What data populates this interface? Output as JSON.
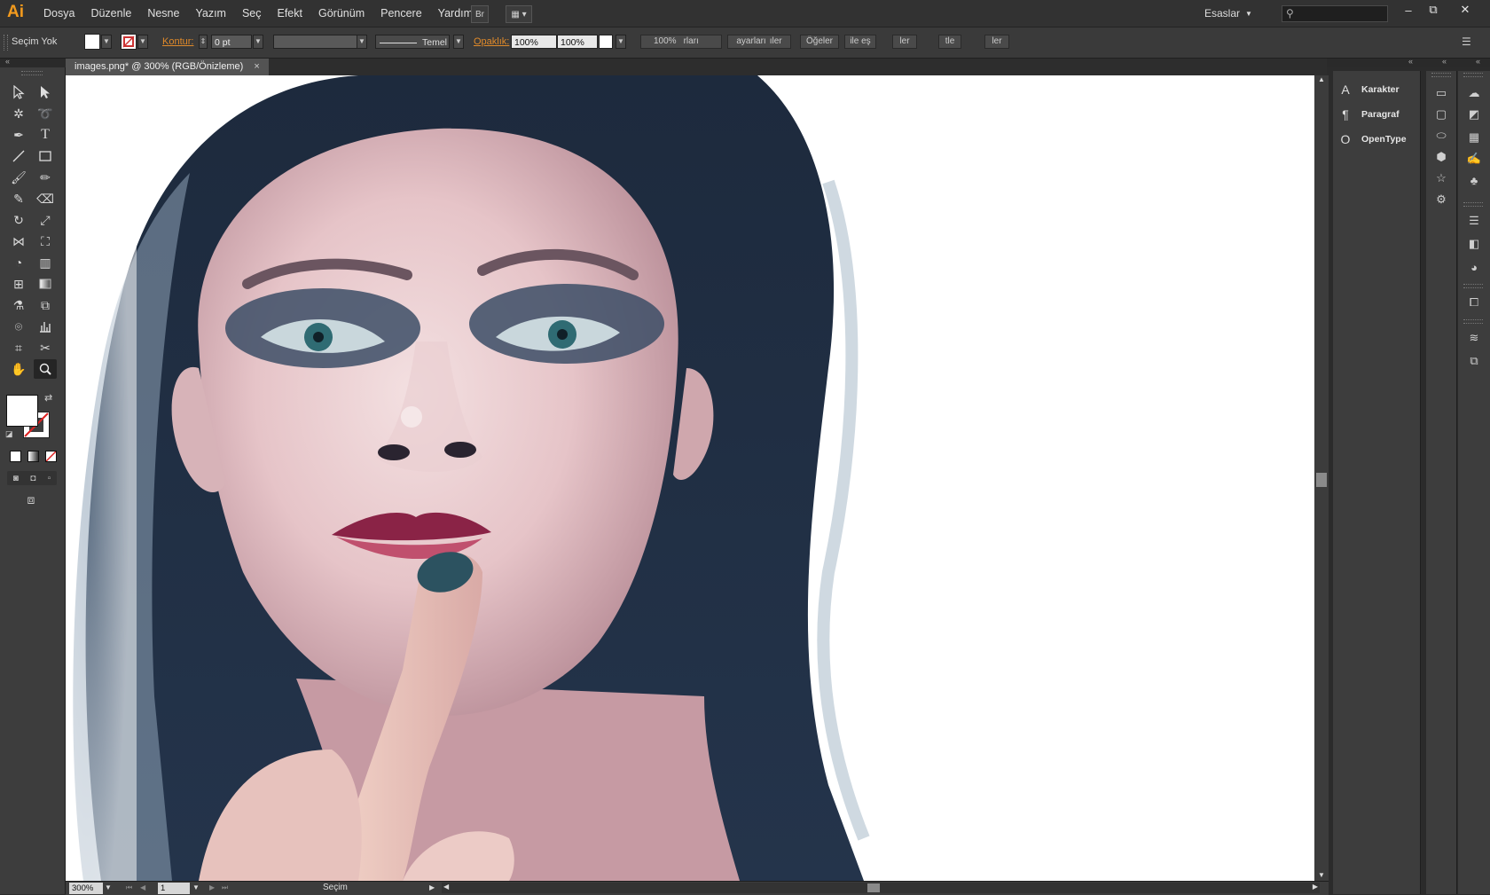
{
  "app": {
    "logo": "Ai"
  },
  "menu": [
    "Dosya",
    "Düzenle",
    "Nesne",
    "Yazım",
    "Seç",
    "Efekt",
    "Görünüm",
    "Pencere",
    "Yardım"
  ],
  "menubar": {
    "bridge_label": "Br",
    "workspace": "Esaslar",
    "search_placeholder": ""
  },
  "window_controls": {
    "minimize": "–",
    "restore": "⧉",
    "close": "✕"
  },
  "control_bar": {
    "selection": "Seçim Yok",
    "stroke_label": "Kontur:",
    "stroke_value": "0 pt",
    "brush_label": "Temel",
    "opacity_label": "Opaklık:",
    "opacity_value": "100%",
    "opacity_value2": "100%",
    "zoom_field": "100%",
    "frag1": "rları",
    "frag2": "ayarları",
    "frag3": "ıler",
    "frag4": "Öğeler",
    "frag5": "ile eş",
    "frag6": "ler",
    "frag7": "tle",
    "frag8": "ler"
  },
  "document": {
    "tab_title": "images.png* @ 300% (RGB/Önizleme)",
    "tab_close": "×",
    "image_description": "painted-portrait"
  },
  "status_bar": {
    "zoom": "300%",
    "page": "1",
    "mode": "Seçim"
  },
  "right_panel": {
    "items": [
      {
        "icon": "A",
        "label": "Karakter"
      },
      {
        "icon": "¶",
        "label": "Paragraf"
      },
      {
        "icon": "O",
        "label": "OpenType"
      }
    ]
  },
  "colors": {
    "accent": "#f29a1d",
    "ui_dark": "#3d3d3d",
    "canvas": "#ffffff"
  }
}
